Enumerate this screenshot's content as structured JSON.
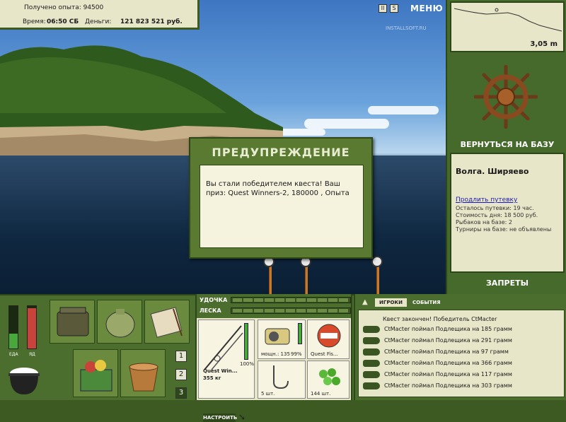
{
  "top": {
    "exp_label": "Получено опыта: 94500",
    "time_label": "Время:",
    "time_value": "06:50 СБ",
    "money_label": "Деньги:",
    "money_value": "121 823 521 руб.",
    "pause_icon": "II",
    "settings_icon": "S",
    "menu": "МЕНЮ",
    "watermark": "INSTALLSOFT.RU"
  },
  "depth": {
    "value": "3,05 m"
  },
  "right": {
    "return_base": "ВЕРНУТЬСЯ НА БАЗУ",
    "base_name": "Волга. Ширяево",
    "buy_permit": "Продлить путевку",
    "lines": [
      "Осталось путевки: 19 час.",
      "Стоимость дня: 18 500 руб.",
      "Рыбаков на базе: 2",
      "Турниры на базе: не объявлены"
    ],
    "bans": "ЗАПРЕТЫ"
  },
  "dialog": {
    "title": "ПРЕДУПРЕЖДЕНИЕ",
    "message": "Вы стали победителем квеста! Ваш приз: Quest Winners-2, 180000 , Опыта"
  },
  "gauges": {
    "food_label": "ЕДА",
    "poison_label": "ЯД",
    "food_level": 0.35,
    "poison_level": 0.95
  },
  "number_buttons": [
    "1",
    "2",
    "3"
  ],
  "tackle": {
    "rod_label": "УДОЧКА",
    "line_label": "ЛЕСКА",
    "rod_name": "Quest Win...",
    "rod_weight": "355 кг",
    "rod_percent": "100%",
    "reel_power": "мощн.: 135",
    "reel_percent": "99%",
    "bait_name": "Quest Fis...",
    "hook_count": "5 шт.",
    "bait_count": "144 шт.",
    "setup_button": "НАСТРОИТЬ"
  },
  "events": {
    "tab_players": "ИГРОКИ",
    "tab_events": "СОБЫТИЯ",
    "header": "Квест закончен! Победитель CtMacter",
    "rows": [
      "CtMacter поймал Подлещика на 185 грамм",
      "CtMacter поймал Подлещика на 291 грамм",
      "CtMacter поймал Подлещика на 97 грамм",
      "CtMacter поймал Подлещика на 366 грамм",
      "CtMacter поймал Подлещика на 117 грамм",
      "CtMacter поймал Подлещика на 303 грамм"
    ]
  },
  "colors": {
    "panel_green": "#4b6d2e",
    "cream": "#e8e6c8",
    "rod_orange": "#c9782a"
  }
}
